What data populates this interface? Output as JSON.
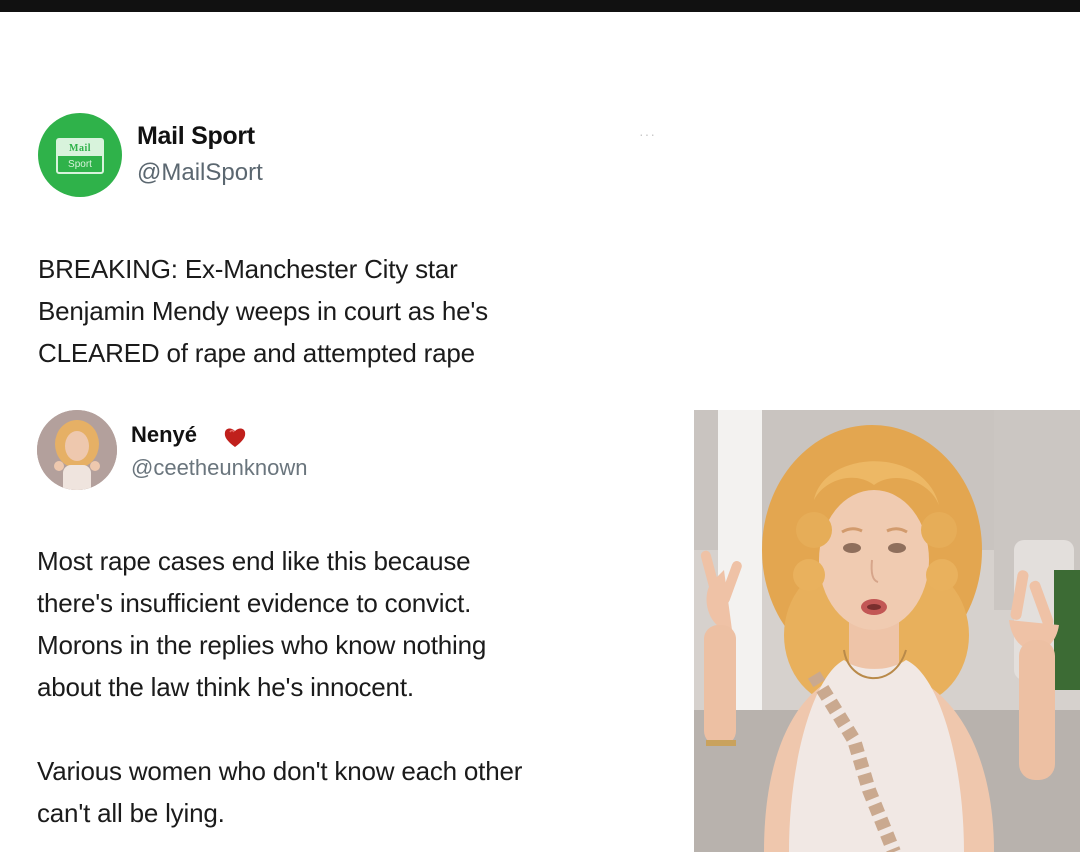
{
  "tweet1": {
    "avatar_logo_top": "Mail",
    "avatar_logo_bottom": "Sport",
    "name": "Mail Sport",
    "handle": "@MailSport",
    "more": "···",
    "text_lines": [
      "BREAKING: Ex-Manchester City star",
      "Benjamin Mendy weeps in court as he's",
      "CLEARED of rape and attempted rape"
    ]
  },
  "tweet2": {
    "name": "Nenyé",
    "badge_icon": "red-heart-icon",
    "handle": "@ceetheunknown",
    "text_lines": [
      "Most rape cases end like this because",
      "there's insufficient evidence to convict.",
      "Morons in the replies who know nothing",
      "about the law think he's innocent."
    ],
    "text_lines_2": [
      "Various women who don't know each other",
      "can't all be lying."
    ]
  },
  "colors": {
    "mail_green": "#2fb24a",
    "handle_gray": "#5b6770",
    "hair": "#e9b35a",
    "skin": "#efc7ad"
  }
}
